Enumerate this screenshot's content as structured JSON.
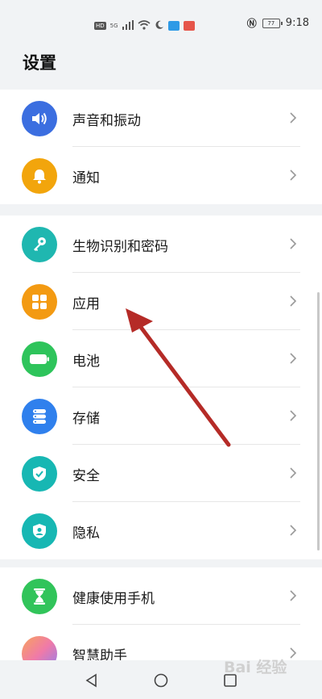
{
  "status_bar": {
    "network_left": "HD",
    "signal": "5G",
    "time": "9:18",
    "battery_level": "77"
  },
  "page": {
    "title": "设置"
  },
  "groups": [
    {
      "items": [
        {
          "label": "声音和振动",
          "icon": "speaker-icon",
          "color": "#3b6ee0"
        },
        {
          "label": "通知",
          "icon": "bell-icon",
          "color": "#f2a50c"
        }
      ]
    },
    {
      "items": [
        {
          "label": "生物识别和密码",
          "icon": "key-icon",
          "color": "#1fb7b0"
        },
        {
          "label": "应用",
          "icon": "apps-grid-icon",
          "color": "#f39a12"
        },
        {
          "label": "电池",
          "icon": "battery-icon",
          "color": "#2ec45b"
        },
        {
          "label": "存储",
          "icon": "storage-icon",
          "color": "#2f80ed"
        },
        {
          "label": "安全",
          "icon": "shield-check-icon",
          "color": "#17b7b3"
        },
        {
          "label": "隐私",
          "icon": "privacy-icon",
          "color": "#17b7b3"
        }
      ]
    },
    {
      "items": [
        {
          "label": "健康使用手机",
          "icon": "hourglass-icon",
          "color": "#31c45a"
        },
        {
          "label": "智慧助手",
          "icon": "assistant-icon",
          "color": "#f08a9a"
        }
      ]
    }
  ],
  "annotation": {
    "arrow_color": "#b52b27"
  },
  "watermark": "Bai 经验"
}
